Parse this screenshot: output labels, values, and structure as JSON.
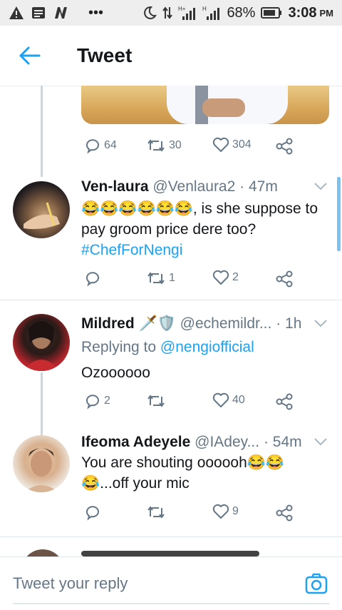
{
  "status_bar": {
    "battery_percent": "68%",
    "time": "3:08",
    "ampm": "PM",
    "dots": "•••",
    "network_1": "1",
    "network_2": "H+",
    "network_3": "H"
  },
  "header": {
    "title": "Tweet"
  },
  "first_tweet_actions": {
    "replies": "64",
    "retweets": "30",
    "likes": "304"
  },
  "tweets": [
    {
      "name": "Ven-laura",
      "handle": "@Venlaura2",
      "time": "· 47m",
      "body_emoji": "😂😂😂😂😂😂",
      "body_text": ", is she suppose to pay groom price dere too?",
      "hashtag": "#ChefForNengi",
      "replies": "",
      "retweets": "1",
      "likes": "2"
    },
    {
      "name": "Mildred",
      "name_emoji": "🗡️🛡️",
      "handle": "@echemildr...",
      "time": "· 1h",
      "replying_label": "Replying to",
      "replying_to": "@nengiofficial",
      "body_text": "Ozoooooo",
      "replies": "2",
      "retweets": "",
      "likes": "40"
    },
    {
      "name": "Ifeoma Adeyele",
      "handle": "@IAdey...",
      "time": "· 54m",
      "body_text_1": "You are shouting oooooh",
      "body_emoji_1": "😂😂",
      "body_emoji_2": "😂",
      "body_text_2": "...off your mic",
      "replies": "",
      "retweets": "",
      "likes": "9"
    }
  ],
  "reply_bar": {
    "placeholder": "Tweet your reply"
  },
  "colors": {
    "accent": "#1da1f2",
    "muted": "#657786"
  }
}
